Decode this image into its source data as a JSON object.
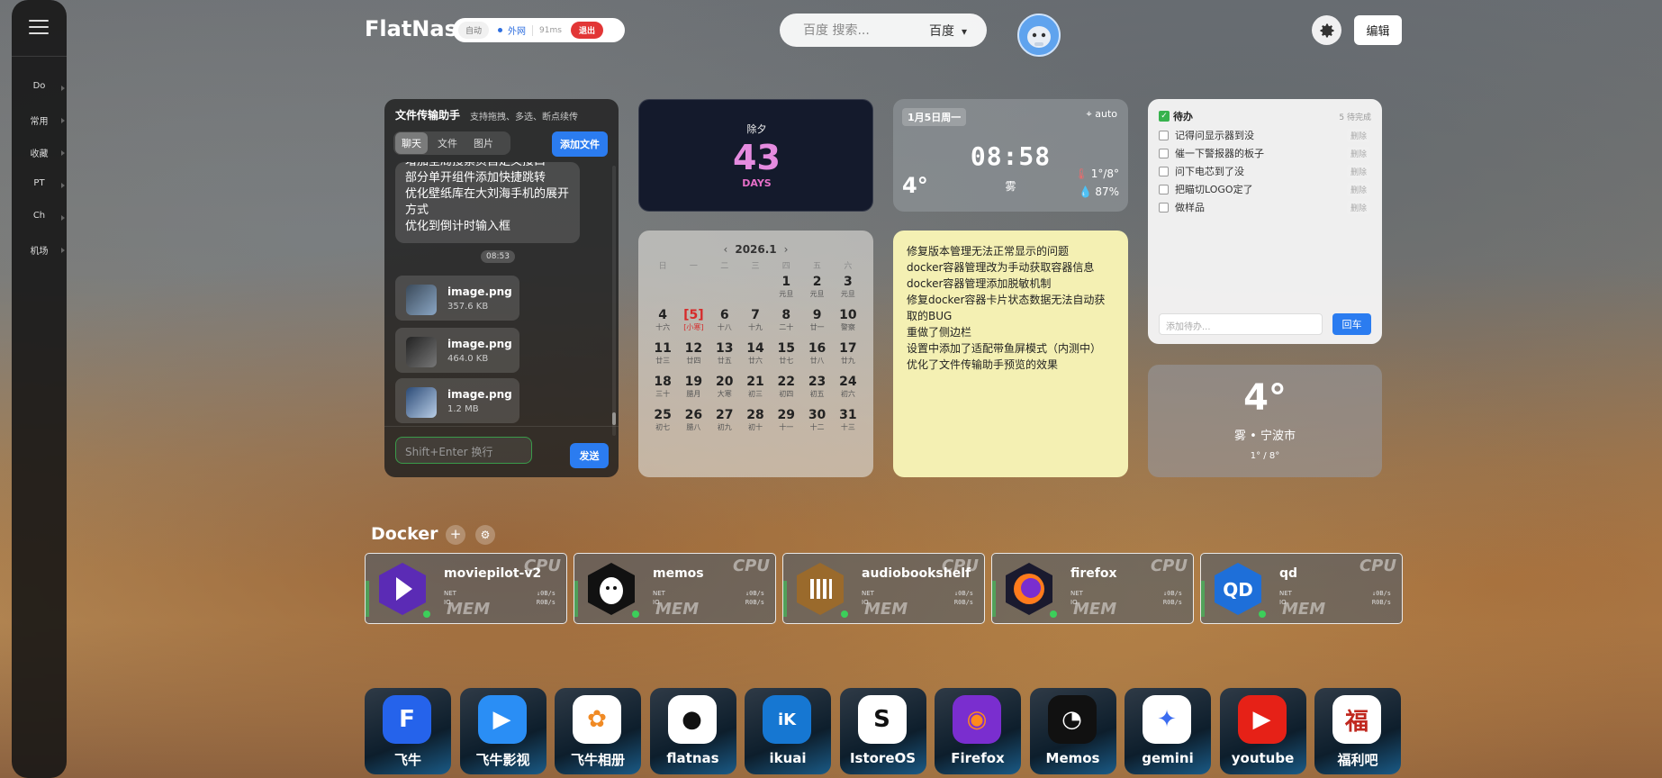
{
  "sidebar": {
    "items": [
      {
        "label": "Do"
      },
      {
        "label": "常用"
      },
      {
        "label": "收藏"
      },
      {
        "label": "PT"
      },
      {
        "label": "Ch"
      },
      {
        "label": "机场"
      }
    ]
  },
  "header": {
    "brand": "FlatNas",
    "net": {
      "auto": "自动",
      "mode": "外网",
      "latency": "91ms",
      "logout": "退出"
    },
    "search": {
      "placeholder": "百度 搜索...",
      "engine": "百度"
    },
    "edit_label": "编辑"
  },
  "transfer": {
    "title": "文件传输助手",
    "subtitle": "支持拖拽、多选、断点续传",
    "tabs": [
      "聊天",
      "文件",
      "图片"
    ],
    "add_label": "添加文件",
    "message_lines": [
      "增加全局搜索页自定义接口",
      "部分单开组件添加快捷跳转",
      "优化壁纸库在大刘海手机的展开",
      "方式",
      "优化到倒计时输入框"
    ],
    "time": "08:53",
    "files": [
      {
        "name": "image.png",
        "size": "357.6 KB"
      },
      {
        "name": "image.png",
        "size": "464.0 KB"
      },
      {
        "name": "image.png",
        "size": "1.2 MB"
      }
    ],
    "input_placeholder": "Shift+Enter 换行",
    "send_label": "发送"
  },
  "countdown": {
    "label": "除夕",
    "value": "43",
    "unit": "DAYS"
  },
  "clock": {
    "date": "1月5日周一",
    "location": "auto",
    "time": "08:58",
    "temp": "4°",
    "condition": "雾",
    "range": "1°/8°",
    "humidity": "87%"
  },
  "calendar": {
    "month": "2026.1",
    "weekdays": [
      "日",
      "一",
      "二",
      "三",
      "四",
      "五",
      "六"
    ],
    "offset": 4,
    "days": [
      {
        "d": "1",
        "l": "元旦"
      },
      {
        "d": "2",
        "l": "元旦"
      },
      {
        "d": "3",
        "l": "元旦"
      },
      {
        "d": "4",
        "l": "十六"
      },
      {
        "d": "[5]",
        "l": "[小寒]",
        "today": true
      },
      {
        "d": "6",
        "l": "十八"
      },
      {
        "d": "7",
        "l": "十九"
      },
      {
        "d": "8",
        "l": "二十"
      },
      {
        "d": "9",
        "l": "廿一"
      },
      {
        "d": "10",
        "l": "警察"
      },
      {
        "d": "11",
        "l": "廿三"
      },
      {
        "d": "12",
        "l": "廿四"
      },
      {
        "d": "13",
        "l": "廿五"
      },
      {
        "d": "14",
        "l": "廿六"
      },
      {
        "d": "15",
        "l": "廿七"
      },
      {
        "d": "16",
        "l": "廿八"
      },
      {
        "d": "17",
        "l": "廿九"
      },
      {
        "d": "18",
        "l": "三十"
      },
      {
        "d": "19",
        "l": "腊月"
      },
      {
        "d": "20",
        "l": "大寒"
      },
      {
        "d": "21",
        "l": "初三"
      },
      {
        "d": "22",
        "l": "初四"
      },
      {
        "d": "23",
        "l": "初五"
      },
      {
        "d": "24",
        "l": "初六"
      },
      {
        "d": "25",
        "l": "初七"
      },
      {
        "d": "26",
        "l": "腊八"
      },
      {
        "d": "27",
        "l": "初九"
      },
      {
        "d": "28",
        "l": "初十"
      },
      {
        "d": "29",
        "l": "十一"
      },
      {
        "d": "30",
        "l": "十二"
      },
      {
        "d": "31",
        "l": "十三"
      }
    ]
  },
  "note": {
    "lines": [
      "修复版本管理无法正常显示的问题",
      "docker容器管理改为手动获取容器信息",
      "docker容器管理添加脱敏机制",
      "修复docker容器卡片状态数据无法自动获",
      "取的BUG",
      "重做了侧边栏",
      "设置中添加了适配带鱼屏模式（内测中）",
      "优化了文件传输助手预览的效果"
    ]
  },
  "todo": {
    "title": "待办",
    "count": "5 待完成",
    "items": [
      "记得问显示器到没",
      "催一下警报器的板子",
      "问下电芯到了没",
      "把瞄切LOGO定了",
      "做样品"
    ],
    "delete_label": "删除",
    "input_placeholder": "添加待办...",
    "submit_label": "回车"
  },
  "weather": {
    "temp": "4°",
    "condition": "雾 • 宁波市",
    "range": "1° / 8°"
  },
  "docker": {
    "title": "Docker",
    "containers": [
      {
        "name": "moviepilot-v2",
        "net_label": "NET",
        "io_label": "IO",
        "net": "↓0B/s",
        "io": "R0B/s",
        "cpu": "CPU",
        "mem": "MEM"
      },
      {
        "name": "memos",
        "net_label": "NET",
        "io_label": "IO",
        "net": "↓0B/s",
        "io": "R0B/s",
        "cpu": "CPU",
        "mem": "MEM"
      },
      {
        "name": "audiobookshelf",
        "net_label": "NET",
        "io_label": "IO",
        "net": "↓0B/s",
        "io": "R0B/s",
        "cpu": "CPU",
        "mem": "MEM"
      },
      {
        "name": "firefox",
        "net_label": "NET",
        "io_label": "IO",
        "net": "↓0B/s",
        "io": "R0B/s",
        "cpu": "CPU",
        "mem": "MEM"
      },
      {
        "name": "qd",
        "net_label": "NET",
        "io_label": "IO",
        "net": "↓0B/s",
        "io": "R0B/s",
        "cpu": "CPU",
        "mem": "MEM"
      }
    ]
  },
  "apps": [
    {
      "label": "飞牛",
      "icon": "fn-icon",
      "glyph": "F",
      "color": "#2563eb",
      "fg": "#ffffff"
    },
    {
      "label": "飞牛影视",
      "icon": "fn-video-icon",
      "glyph": "▶",
      "color": "#2a8ef5",
      "fg": "#ffffff"
    },
    {
      "label": "飞牛相册",
      "icon": "photos-icon",
      "glyph": "✿",
      "color": "#ffffff",
      "fg": "#f08a24"
    },
    {
      "label": "flatnas",
      "icon": "github-icon",
      "glyph": "●",
      "color": "#ffffff",
      "fg": "#111111"
    },
    {
      "label": "ikuai",
      "icon": "ikuai-icon",
      "glyph": "iK",
      "color": "#1677d2",
      "fg": "#ffffff"
    },
    {
      "label": "IstoreOS",
      "icon": "istore-icon",
      "glyph": "S",
      "color": "#ffffff",
      "fg": "#111111"
    },
    {
      "label": "Firefox",
      "icon": "firefox-icon",
      "glyph": "◉",
      "color": "#7a2ecf",
      "fg": "#ff8a1c"
    },
    {
      "label": "Memos",
      "icon": "memos-icon",
      "glyph": "◔",
      "color": "#111111",
      "fg": "#ffffff"
    },
    {
      "label": "gemini",
      "icon": "gemini-icon",
      "glyph": "✦",
      "color": "#ffffff",
      "fg": "#3b6cf0"
    },
    {
      "label": "youtube",
      "icon": "youtube-icon",
      "glyph": "▶",
      "color": "#e62117",
      "fg": "#ffffff"
    },
    {
      "label": "福利吧",
      "icon": "fuliba-icon",
      "glyph": "福",
      "color": "#ffffff",
      "fg": "#c0281f"
    }
  ]
}
